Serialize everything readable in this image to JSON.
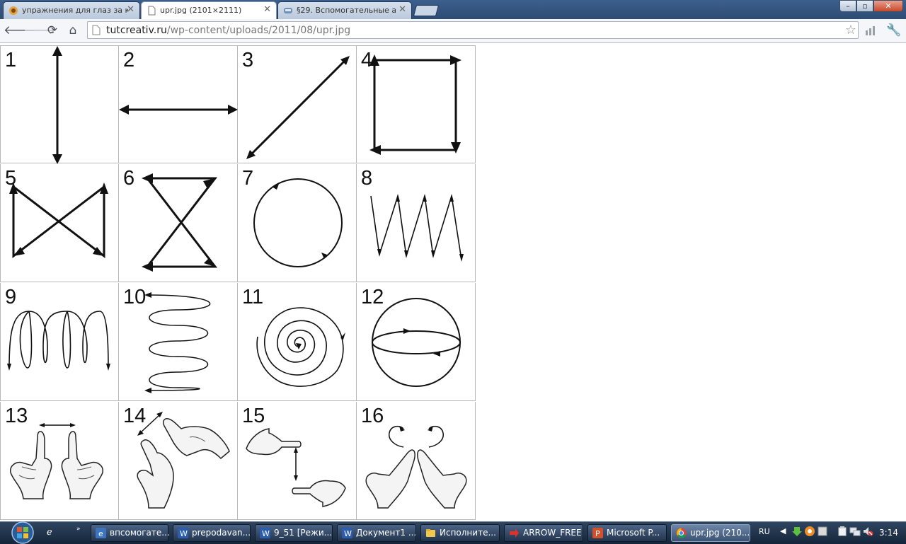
{
  "browser": {
    "tabs": [
      {
        "title": "упражнения для глаз за к",
        "active": false
      },
      {
        "title": "upr.jpg (2101×2111)",
        "active": true
      },
      {
        "title": "§29. Вспомогательные ал",
        "active": false
      }
    ],
    "url_domain": "tutcreativ.ru",
    "url_path": "/wp-content/uploads/2011/08/upr.jpg",
    "window_controls": {
      "minimize": "–",
      "maximize": "▫",
      "close": "✕"
    }
  },
  "image_cells": [
    {
      "number": "1"
    },
    {
      "number": "2"
    },
    {
      "number": "3"
    },
    {
      "number": "4"
    },
    {
      "number": "5"
    },
    {
      "number": "6"
    },
    {
      "number": "7"
    },
    {
      "number": "8"
    },
    {
      "number": "9"
    },
    {
      "number": "10"
    },
    {
      "number": "11"
    },
    {
      "number": "12"
    },
    {
      "number": "13"
    },
    {
      "number": "14"
    },
    {
      "number": "15"
    },
    {
      "number": "16"
    }
  ],
  "taskbar": {
    "items": [
      {
        "label": "впсомогате...",
        "icon": "ie-icon",
        "active": false
      },
      {
        "label": "prepodavan...",
        "icon": "word-icon",
        "active": false
      },
      {
        "label": "9_51 [Режи...",
        "icon": "word-icon",
        "active": false
      },
      {
        "label": "Документ1 ...",
        "icon": "word-icon",
        "active": false
      },
      {
        "label": "Исполните...",
        "icon": "folder-icon",
        "active": false
      },
      {
        "label": "ARROW_FREE",
        "icon": "arrow-icon",
        "active": false
      },
      {
        "label": "Microsoft P...",
        "icon": "powerpoint-icon",
        "active": false
      },
      {
        "label": "upr.jpg (210...",
        "icon": "chrome-icon",
        "active": true
      }
    ],
    "language": "RU",
    "clock": "3:14"
  },
  "colors": {
    "titlebar": "#2e4c74",
    "taskbar": "#1d2d44",
    "line": "#111111"
  }
}
